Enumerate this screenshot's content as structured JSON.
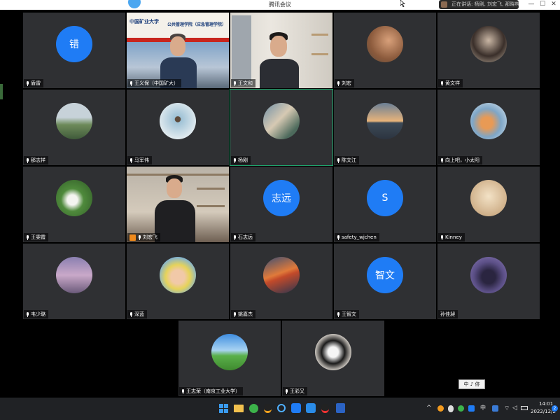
{
  "window": {
    "title": "腾讯会议"
  },
  "speaking": {
    "text": "正在讲话: 杨刚, 刘宏飞, 那晓梓;"
  },
  "participants": [
    {
      "name": "盾雷",
      "avatar_text": "错"
    },
    {
      "name": "王义保（中国矿大）"
    },
    {
      "name": "王文和"
    },
    {
      "name": "刘宏"
    },
    {
      "name": "黄文祥"
    },
    {
      "name": "那志祥"
    },
    {
      "name": "马军伟"
    },
    {
      "name": "杨刚"
    },
    {
      "name": "陈文江"
    },
    {
      "name": "向上吧，小太阳"
    },
    {
      "name": "王雯霞"
    },
    {
      "name": "刘宏飞"
    },
    {
      "name": "石志远",
      "avatar_text": "志远"
    },
    {
      "name": "safety_wjchen",
      "avatar_text": "S"
    },
    {
      "name": "Kinney"
    },
    {
      "name": "韦少璐"
    },
    {
      "name": "深蓝"
    },
    {
      "name": "姚嘉杰"
    },
    {
      "name": "王智文",
      "avatar_text": "智文"
    },
    {
      "name": "孙佳昶"
    },
    {
      "name": "王志荣（南京工业大学）"
    },
    {
      "name": "王彩又"
    }
  ],
  "scene": {
    "banner_left": "中国矿业大学",
    "banner_right": "公共管理学院（应急管理学院）"
  },
  "ime": {
    "text": "中 ♪ 㑊"
  },
  "taskbar": {
    "time": "14:01",
    "date": "2022/12/2",
    "lang": "中",
    "badge": "2"
  },
  "colors": {
    "tile_bg": "#2f3033",
    "accent_blue": "#1f7cf5",
    "active_border": "#1ea36b",
    "taskbar_bg": "#202225"
  }
}
